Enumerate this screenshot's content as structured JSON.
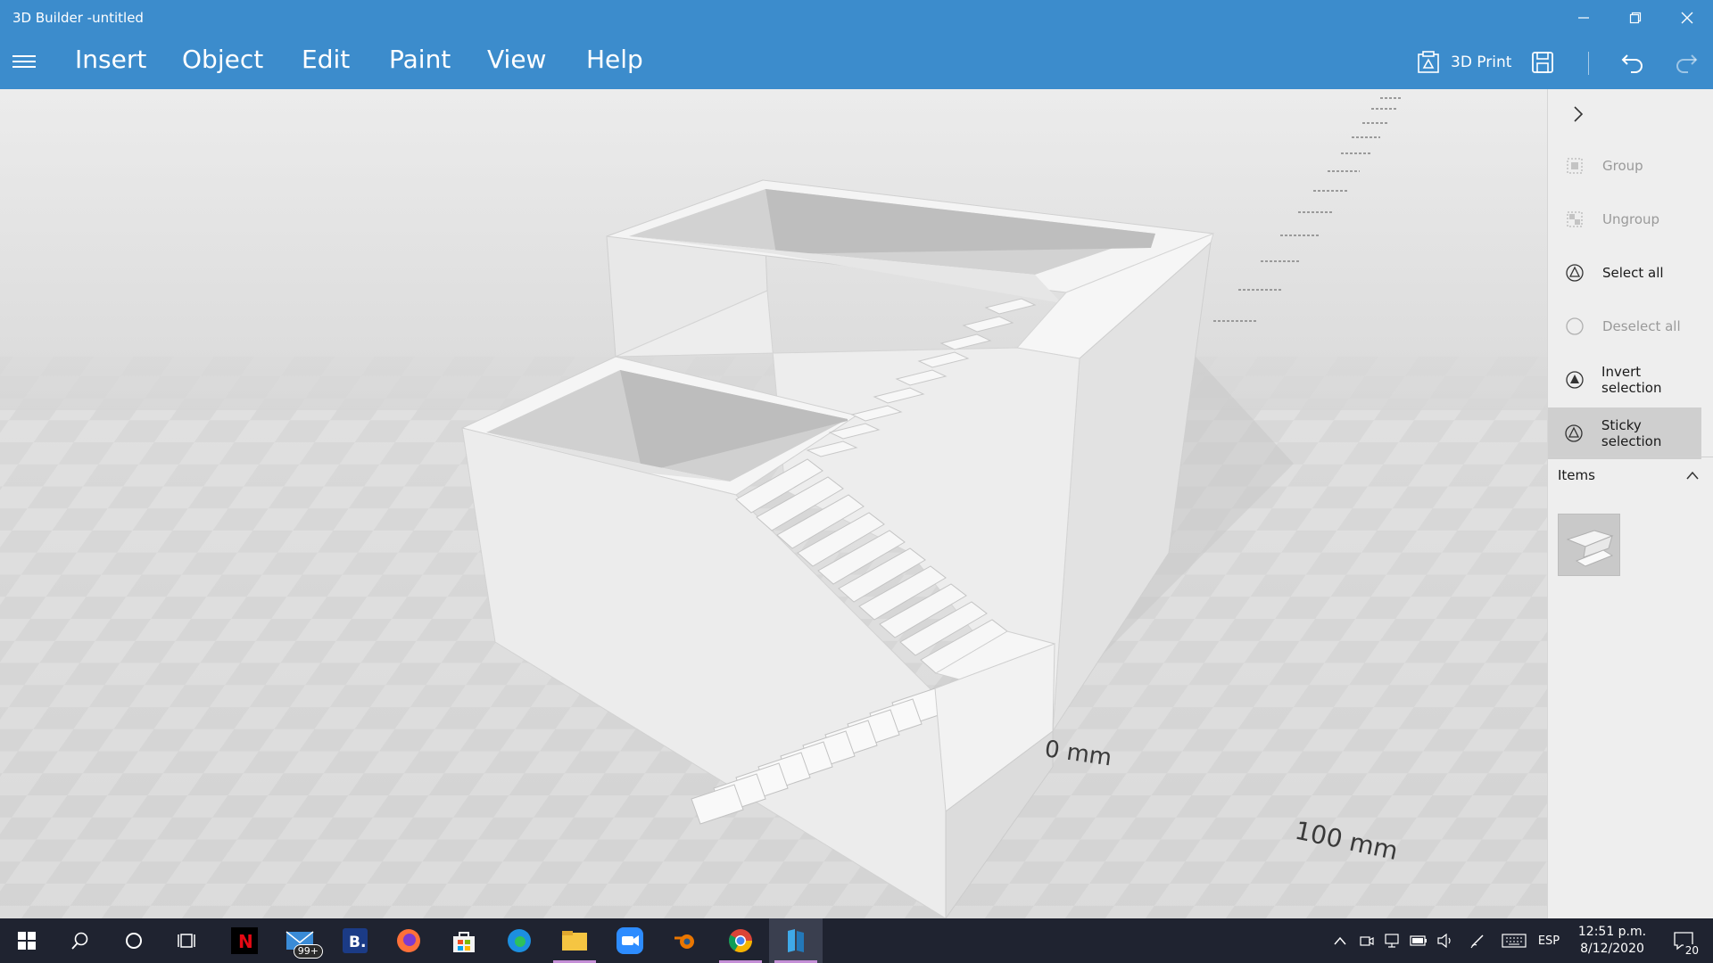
{
  "window": {
    "title": "3D Builder -untitled",
    "controls": [
      "minimize-icon",
      "restore-icon",
      "close-icon"
    ]
  },
  "menu": {
    "items": [
      "Insert",
      "Object",
      "Edit",
      "Paint",
      "View",
      "Help"
    ],
    "print_label": "3D Print"
  },
  "viewport": {
    "labels": [
      "0 mm",
      "100 mm"
    ]
  },
  "panel": {
    "actions": [
      {
        "label": "Group",
        "enabled": false,
        "icon": "group-icon"
      },
      {
        "label": "Ungroup",
        "enabled": false,
        "icon": "ungroup-icon"
      },
      {
        "label": "Select all",
        "enabled": true,
        "icon": "select-all-icon"
      },
      {
        "label": "Deselect all",
        "enabled": false,
        "icon": "deselect-all-icon"
      },
      {
        "label": "Invert selection",
        "enabled": true,
        "icon": "invert-selection-icon"
      },
      {
        "label": "Sticky selection",
        "enabled": true,
        "active": true,
        "icon": "sticky-selection-icon"
      }
    ],
    "items_header": "Items"
  },
  "taskbar": {
    "mail_badge": "99+",
    "language": "ESP",
    "time": "12:51 p.m.",
    "date": "8/12/2020",
    "notification_count": "20"
  },
  "colors": {
    "accent": "#3c8ccc",
    "taskbar": "#1f2330",
    "panel": "#eeeeee"
  }
}
